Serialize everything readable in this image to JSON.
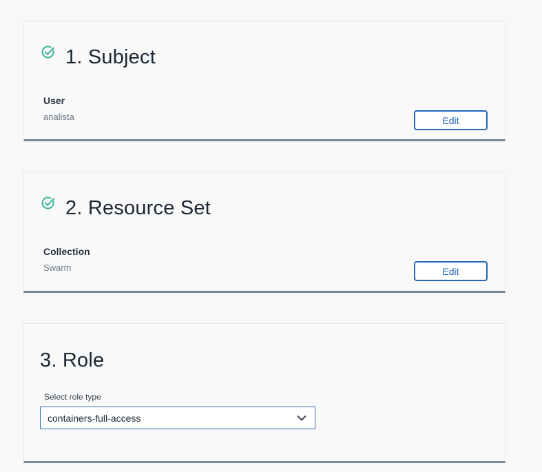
{
  "subject": {
    "title": "1. Subject",
    "completed": true,
    "field_label": "User",
    "field_value": "analista",
    "edit_label": "Edit"
  },
  "resource_set": {
    "title": "2. Resource Set",
    "completed": true,
    "field_label": "Collection",
    "field_value": "Swarm",
    "edit_label": "Edit"
  },
  "role": {
    "title": "3. Role",
    "select_label": "Select role type",
    "select_value": "containers-full-access"
  },
  "colors": {
    "check_green": "#3ab594",
    "accent_blue": "#2566b8",
    "card_border_bottom": "#7d8895"
  },
  "icons": {
    "check": "check-circle-icon",
    "chevron": "chevron-down-icon"
  }
}
